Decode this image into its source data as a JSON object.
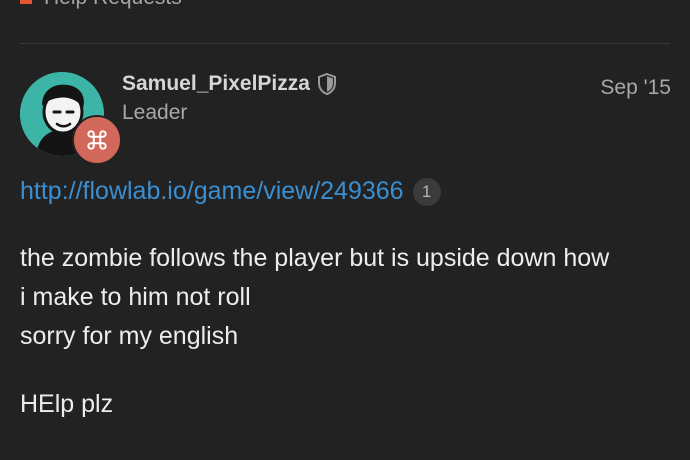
{
  "category": {
    "label": "Help Requests",
    "color": "#e45735"
  },
  "post": {
    "author": {
      "username": "Samuel_PixelPizza",
      "title": "Leader",
      "avatar_icon": "avatar-cartoon-face",
      "flair_icon": "command-key-icon",
      "badge_icon": "shield-icon"
    },
    "date": "Sep '15",
    "link": {
      "text": "http://flowlab.io/game/view/249366",
      "click_count": "1",
      "color": "#3b8fd0"
    },
    "body_lines": [
      "the zombie follows the player but is upside down how",
      "i make to him not roll",
      "sorry for my english"
    ],
    "closing": "HElp plz"
  },
  "colors": {
    "background": "#222222",
    "text": "#ededed",
    "muted": "#a8a8a8",
    "avatar_bg": "#3cb5a6",
    "flair_bg": "#d2685a"
  }
}
